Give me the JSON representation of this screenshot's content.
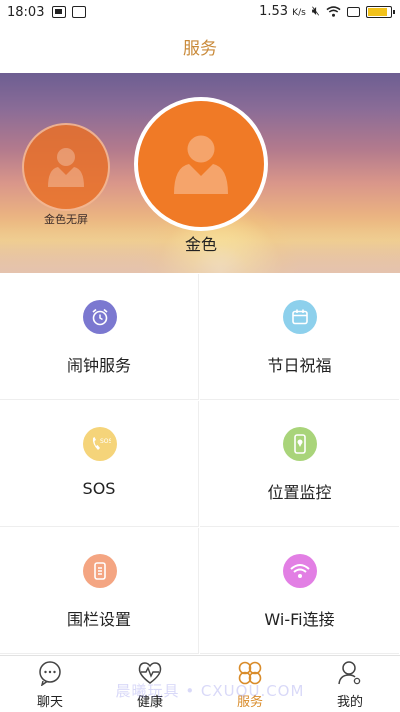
{
  "status_bar": {
    "time": "18:03",
    "speed_value": "1.53",
    "speed_unit": "K/s"
  },
  "header": {
    "title": "服务"
  },
  "banner": {
    "devices": [
      {
        "label": "金色无屏",
        "selected": false
      },
      {
        "label": "金色",
        "selected": true
      }
    ]
  },
  "services": [
    {
      "label": "闹钟服务",
      "icon": "alarm-clock-icon",
      "color": "#7b78d0"
    },
    {
      "label": "节日祝福",
      "icon": "calendar-icon",
      "color": "#8dd0ec"
    },
    {
      "label": "SOS",
      "icon": "sos-phone-icon",
      "color": "#f5d47a"
    },
    {
      "label": "位置监控",
      "icon": "location-phone-icon",
      "color": "#a9d47a"
    },
    {
      "label": "围栏设置",
      "icon": "fence-device-icon",
      "color": "#f4a582"
    },
    {
      "label": "Wi-Fi连接",
      "icon": "wifi-icon",
      "color": "#e27fe4"
    }
  ],
  "bottom_nav": {
    "items": [
      {
        "label": "聊天",
        "icon": "chat-icon",
        "active": false
      },
      {
        "label": "健康",
        "icon": "heart-pulse-icon",
        "active": false
      },
      {
        "label": "服务",
        "icon": "service-icon",
        "active": true
      },
      {
        "label": "我的",
        "icon": "user-icon",
        "active": false
      }
    ],
    "watermark": "晨曦玩具 • CXUQU.COM"
  },
  "colors": {
    "accent": "#d98c2b",
    "title": "#c98a3a",
    "avatar_orange": "#f07a26"
  }
}
